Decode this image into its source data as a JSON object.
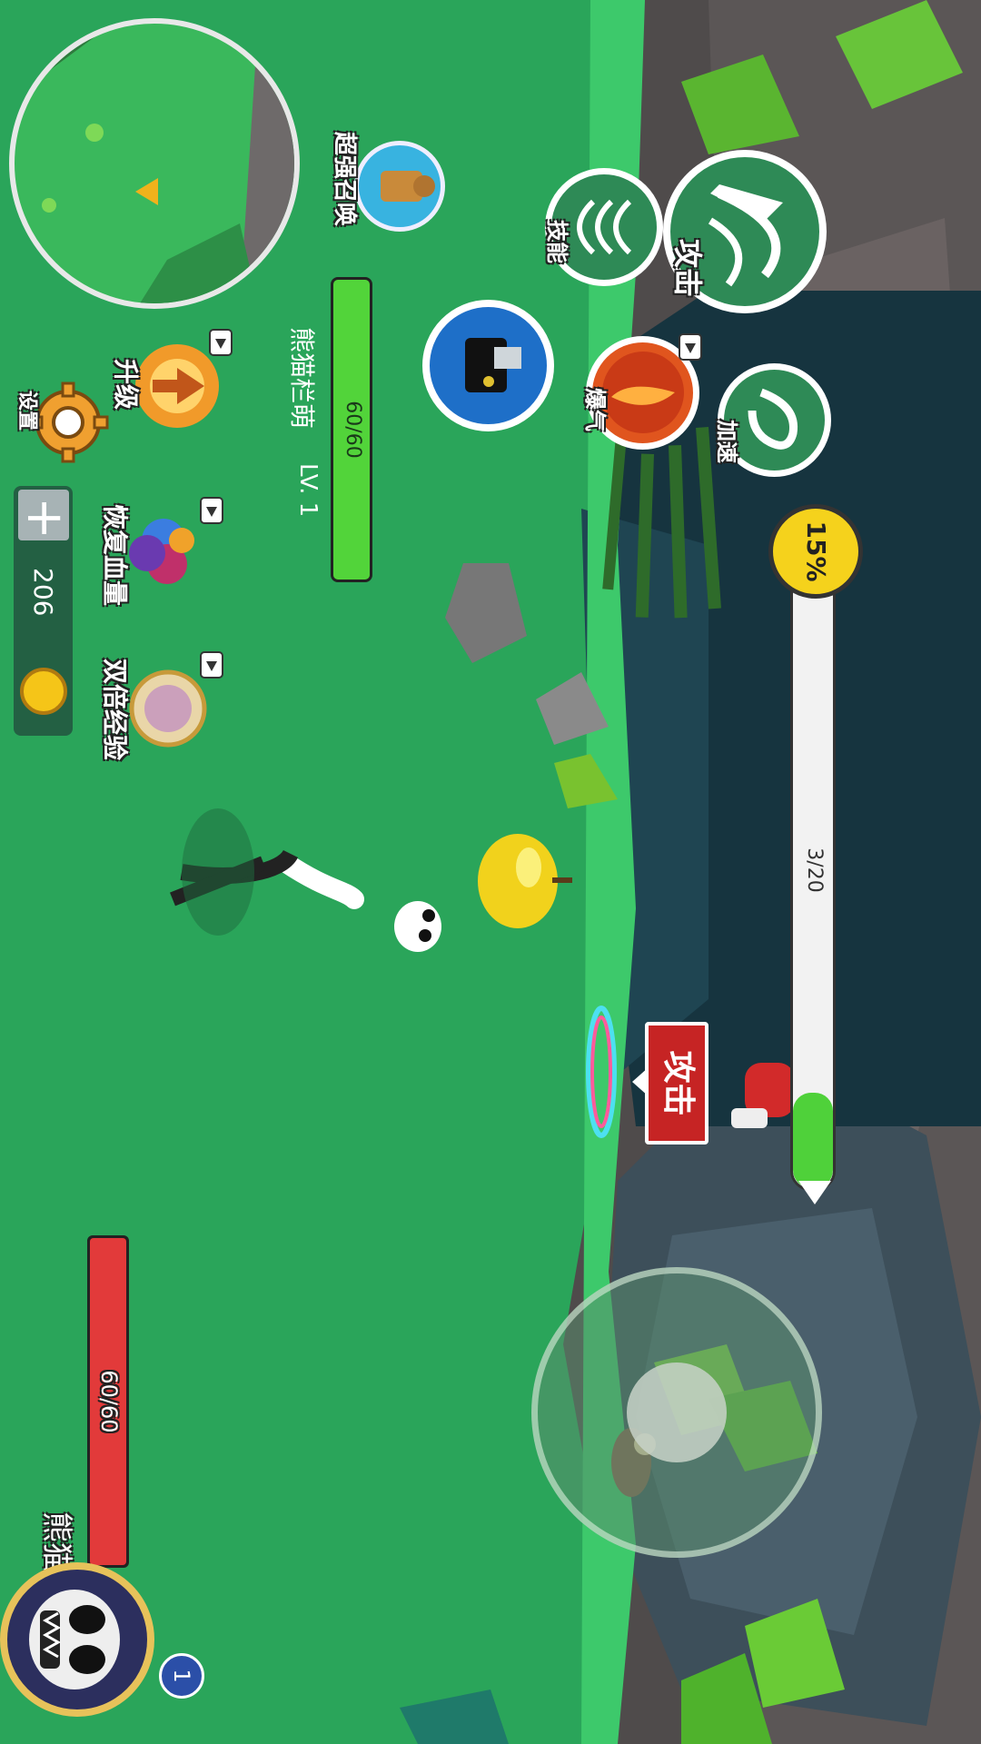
{
  "player": {
    "name": "熊猫栏萌",
    "hp_text": "60/60",
    "hp_fraction": 1.0,
    "level_badge": "1"
  },
  "coins": {
    "value": "206"
  },
  "target": {
    "level": "LV. 1",
    "name": "熊猫栏萌",
    "hp_text": "60/60",
    "hp_fraction": 1.0
  },
  "buttons": {
    "settings": "设置",
    "upgrade": "升级",
    "restore_hp": "恢复血量",
    "double_exp": "双倍经验",
    "super_summon": "超强召唤",
    "skill": "技能",
    "attack": "攻击",
    "burst": "爆气",
    "speed": "加速"
  },
  "bubble": {
    "text": "攻击"
  },
  "progress": {
    "count_text": "3/20",
    "fraction": 0.15,
    "percent_text": "15%"
  },
  "icons": {
    "settings": "gear-icon",
    "coin": "coin-icon",
    "add": "plus-icon",
    "upgrade": "upgrade-icon",
    "restore": "potion-icon",
    "double_exp": "exp-scroll-icon",
    "summon": "golem-icon",
    "skill": "claw-icon",
    "attack": "attack-icon",
    "burst": "fire-icon",
    "speed": "dragon-icon",
    "ad": "video-ad-icon"
  },
  "colors": {
    "grass": "#2aa55a",
    "hp_red": "#e23a3a",
    "hp_green": "#52d43a",
    "badge_blue": "#2b4fa8",
    "coin_gold": "#f5c518"
  }
}
